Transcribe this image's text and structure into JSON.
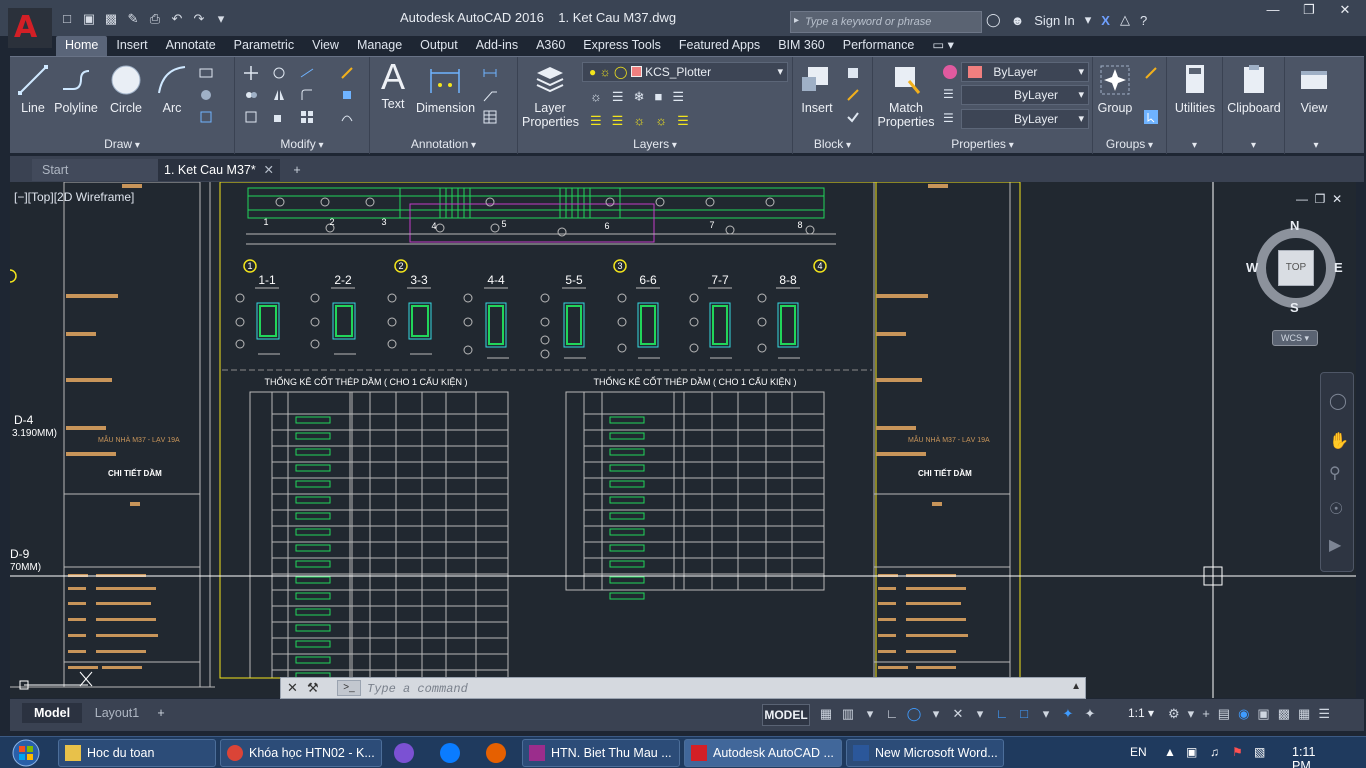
{
  "window": {
    "app_name": "Autodesk AutoCAD 2016",
    "doc_name": "1. Ket Cau M37.dwg",
    "logo_letter": "A"
  },
  "search": {
    "placeholder": "Type a keyword or phrase"
  },
  "account": {
    "sign_in": "Sign In"
  },
  "ribbon_tabs": [
    "Home",
    "Insert",
    "Annotate",
    "Parametric",
    "View",
    "Manage",
    "Output",
    "Add-ins",
    "A360",
    "Express Tools",
    "Featured Apps",
    "BIM 360",
    "Performance"
  ],
  "panels": {
    "draw": {
      "title": "Draw",
      "line": "Line",
      "polyline": "Polyline",
      "circle": "Circle",
      "arc": "Arc"
    },
    "modify": {
      "title": "Modify"
    },
    "annotation": {
      "title": "Annotation",
      "text": "Text",
      "dimension": "Dimension"
    },
    "layers": {
      "title": "Layers",
      "layer_properties_1": "Layer",
      "layer_properties_2": "Properties",
      "current_layer": "KCS_Plotter"
    },
    "block": {
      "title": "Block",
      "insert": "Insert"
    },
    "properties": {
      "title": "Properties",
      "match_1": "Match",
      "match_2": "Properties",
      "color": "ByLayer",
      "linetype": "ByLayer",
      "lineweight": "ByLayer"
    },
    "groups": {
      "title": "Groups",
      "group": "Group"
    },
    "utilities": "Utilities",
    "clipboard": "Clipboard",
    "view": "View"
  },
  "file_tabs": {
    "start": "Start",
    "doc": "1. Ket Cau M37*"
  },
  "viewport": {
    "label": "[−][Top][2D Wireframe]",
    "compass": {
      "n": "N",
      "s": "S",
      "e": "E",
      "w": "W",
      "top": "TOP",
      "wcs": "WCS"
    }
  },
  "drawing_text": {
    "sections": [
      "1-1",
      "2-2",
      "3-3",
      "4-4",
      "5-5",
      "6-6",
      "7-7",
      "8-8"
    ],
    "axis_marks": [
      "1",
      "2",
      "3",
      "4"
    ],
    "span_marks": [
      "1",
      "2",
      "3",
      "4",
      "5",
      "6",
      "7",
      "8"
    ],
    "table_title_left": "THỐNG KÊ CỐT THÉP DẦM ( CHO 1 CẤU KIỆN )",
    "table_title_right": "THỐNG KÊ CỐT THÉP DẦM ( CHO 1 CẤU KIỆN )",
    "left_label_1": "D-4",
    "left_label_2": "3.190MM)",
    "left_label_3": "D-9",
    "left_label_4": "70MM)",
    "stamp_1": "MẪU NHÀ M37 - LẠV 19A",
    "stamp_2": "CHI TIẾT DẦM",
    "stamp_3": "MẪU NHÀ M37 - LẠV 19A",
    "stamp_4": "CHI TIẾT DẦM"
  },
  "command": {
    "placeholder": "Type a command"
  },
  "layout_tabs": {
    "model": "Model",
    "layout1": "Layout1"
  },
  "status": {
    "model": "MODEL",
    "scale": "1:1"
  },
  "taskbar": {
    "items": [
      "Hoc du toan",
      "Khóa học HTN02 - K...",
      "HTN. Biet Thu Mau ...",
      "Autodesk AutoCAD ...",
      "New Microsoft Word..."
    ],
    "lang": "EN",
    "time": "1:11 PM"
  },
  "colors": {
    "accent_red": "#d31f26",
    "cad_green": "#21d65a",
    "cad_cyan": "#35d8e0",
    "cad_yellow": "#f2e41c",
    "cad_magenta": "#c23bc9",
    "cad_tan": "#c8955a"
  }
}
